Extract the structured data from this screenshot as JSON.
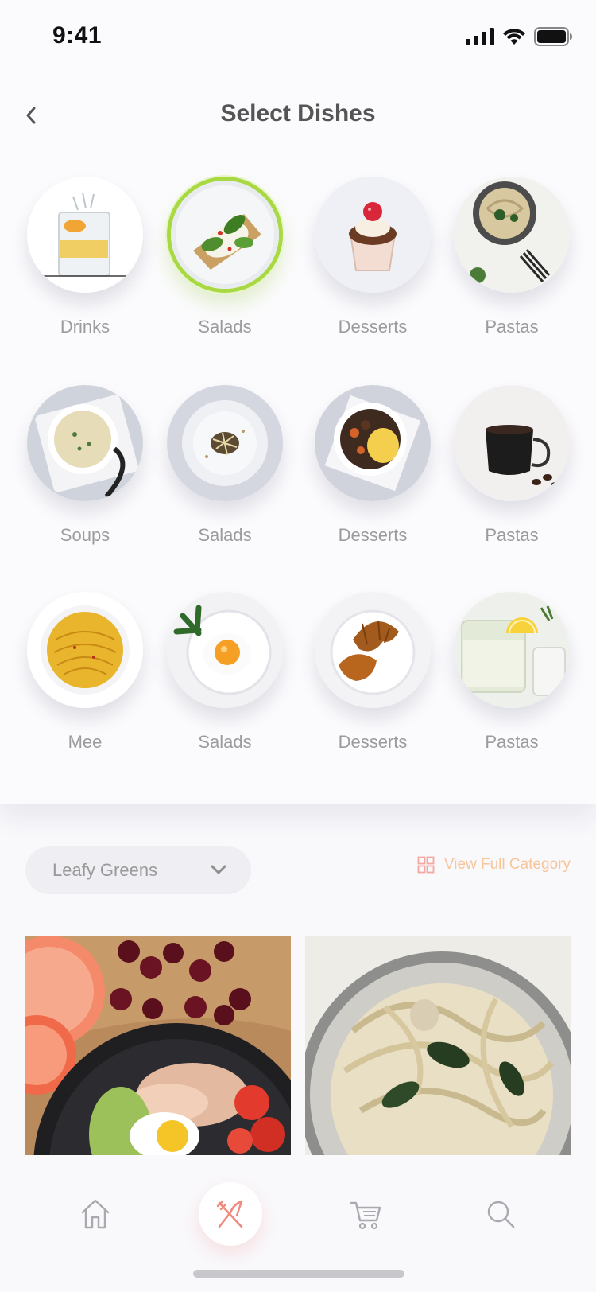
{
  "status_bar": {
    "time": "9:41"
  },
  "header": {
    "title": "Select Dishes",
    "back_icon": "chevron-left-icon"
  },
  "dishes": [
    {
      "label": "Drinks",
      "selected": false,
      "image": "water-glass-lemon"
    },
    {
      "label": "Salads",
      "selected": true,
      "image": "avocado-toast-plate"
    },
    {
      "label": "Desserts",
      "selected": false,
      "image": "cupcake-raspberry"
    },
    {
      "label": "Pastas",
      "selected": false,
      "image": "spinach-pasta-bowl"
    },
    {
      "label": "Soups",
      "selected": false,
      "image": "cream-soup-bowl"
    },
    {
      "label": "Salads",
      "selected": false,
      "image": "sprout-salad-plate"
    },
    {
      "label": "Desserts",
      "selected": false,
      "image": "beef-stew-bowl"
    },
    {
      "label": "Pastas",
      "selected": false,
      "image": "espresso-cup"
    },
    {
      "label": "Mee",
      "selected": false,
      "image": "yellow-noodles"
    },
    {
      "label": "Salads",
      "selected": false,
      "image": "fried-egg-plate"
    },
    {
      "label": "Desserts",
      "selected": false,
      "image": "croissants-plate"
    },
    {
      "label": "Pastas",
      "selected": false,
      "image": "lemonade-glass"
    }
  ],
  "filter": {
    "category": "Leafy Greens",
    "view_full_label": "View Full Category",
    "view_full_icon": "grid-icon"
  },
  "cards": [
    {
      "image": "grapefruit-cherry-chicken-salad"
    },
    {
      "image": "fettuccine-spinach-bowl"
    }
  ],
  "nav": [
    {
      "icon": "home-icon",
      "active": false
    },
    {
      "icon": "fork-knife-icon",
      "active": true
    },
    {
      "icon": "cart-icon",
      "active": false
    },
    {
      "icon": "search-icon",
      "active": false
    }
  ],
  "colors": {
    "accent_green": "#a8d943",
    "accent_orange": "#f7c59a",
    "accent_red": "#f08a7e",
    "text_muted": "#9b9b9b"
  }
}
